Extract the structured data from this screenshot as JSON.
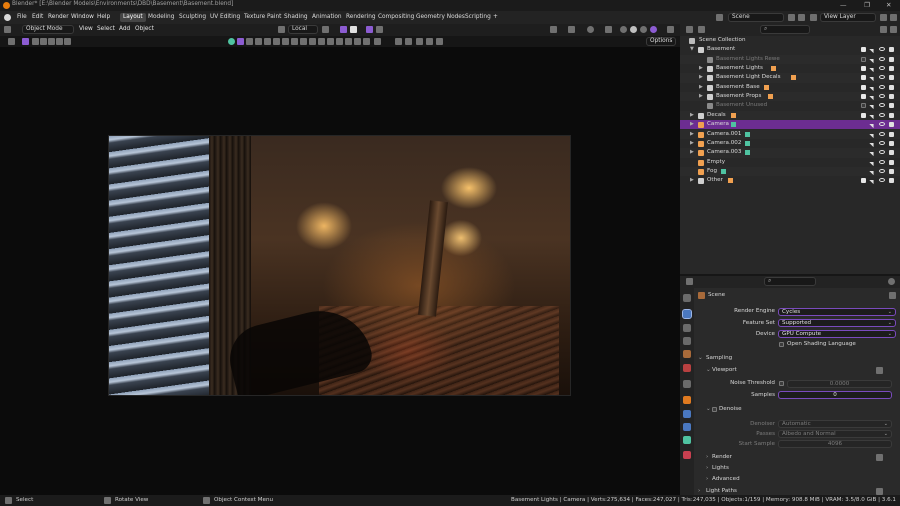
{
  "window": {
    "title": "Blender* [E:\\Blender Models\\Environments\\DBD\\Basement\\Basement.blend]",
    "controls": [
      "—",
      "❐",
      "✕"
    ]
  },
  "topbar": {
    "menus": [
      "File",
      "Edit",
      "Render",
      "Window",
      "Help"
    ],
    "workspaces": [
      "Layout",
      "Modeling",
      "Sculpting",
      "UV Editing",
      "Texture Paint",
      "Shading",
      "Animation",
      "Rendering",
      "Compositing",
      "Geometry Nodes",
      "Scripting"
    ],
    "active_workspace": "Layout",
    "add_tab": "+",
    "scene_name": "Scene",
    "view_layer": "View Layer"
  },
  "viewport_header": {
    "mode": "Object Mode",
    "menus": [
      "View",
      "Select",
      "Add",
      "Object"
    ],
    "transform_orientation": "Local",
    "options_label": "Options"
  },
  "outliner": {
    "root": "Scene Collection",
    "rows": [
      {
        "label": "Basement",
        "indent": 1,
        "icon": "collection-icon",
        "color": "#cfcfcf",
        "dim": false,
        "arrow": "▼",
        "check": true
      },
      {
        "label": "Basement Lights Rewe",
        "indent": 2,
        "icon": "collection-icon",
        "color": "#8a8a8a",
        "dim": true,
        "arrow": "",
        "check": false
      },
      {
        "label": "Basement Lights",
        "indent": 2,
        "icon": "collection-icon",
        "color": "#cfcfcf",
        "dim": false,
        "arrow": "▶",
        "check": true,
        "badge": "light-icon",
        "badgeColor": "#f0a050"
      },
      {
        "label": "Basement Light Decals",
        "indent": 2,
        "icon": "collection-icon",
        "color": "#cfcfcf",
        "dim": false,
        "arrow": "▶",
        "check": true,
        "badge": "funnel-icon",
        "badgeColor": "#f0a050"
      },
      {
        "label": "Basement Base",
        "indent": 2,
        "icon": "collection-icon",
        "color": "#cfcfcf",
        "dim": false,
        "arrow": "▶",
        "check": true,
        "badge": "mesh-icon",
        "badgeColor": "#f0a050"
      },
      {
        "label": "Basement Props",
        "indent": 2,
        "icon": "collection-icon",
        "color": "#cfcfcf",
        "dim": false,
        "arrow": "▶",
        "check": true,
        "badge": "mesh-icon",
        "badgeColor": "#f0a050"
      },
      {
        "label": "Basement Unused",
        "indent": 2,
        "icon": "collection-icon",
        "color": "#8a8a8a",
        "dim": true,
        "arrow": "",
        "check": false
      },
      {
        "label": "Decals",
        "indent": 1,
        "icon": "collection-icon",
        "color": "#cfcfcf",
        "dim": false,
        "arrow": "▶",
        "check": true,
        "badge": "mesh-icon",
        "badgeColor": "#f0a050"
      },
      {
        "label": "Camera",
        "indent": 1,
        "icon": "camera-object-icon",
        "color": "#f0a050",
        "dim": false,
        "arrow": "▶",
        "check": false,
        "selected": true,
        "badge": "camera-data-icon",
        "badgeColor": "#4fc3a1"
      },
      {
        "label": "Camera.001",
        "indent": 1,
        "icon": "camera-object-icon",
        "color": "#f0a050",
        "dim": false,
        "arrow": "▶",
        "check": false,
        "badge": "camera-data-icon",
        "badgeColor": "#4fc3a1"
      },
      {
        "label": "Camera.002",
        "indent": 1,
        "icon": "camera-object-icon",
        "color": "#f0a050",
        "dim": false,
        "arrow": "▶",
        "check": false,
        "badge": "camera-data-icon",
        "badgeColor": "#4fc3a1"
      },
      {
        "label": "Camera.003",
        "indent": 1,
        "icon": "camera-object-icon",
        "color": "#f0a050",
        "dim": false,
        "arrow": "▶",
        "check": false,
        "badge": "camera-data-icon",
        "badgeColor": "#4fc3a1"
      },
      {
        "label": "Empty",
        "indent": 1,
        "icon": "empty-icon",
        "color": "#f0a050",
        "dim": false,
        "arrow": "",
        "check": false
      },
      {
        "label": "Fog",
        "indent": 1,
        "icon": "mesh-object-icon",
        "color": "#f0a050",
        "dim": false,
        "arrow": "",
        "check": false,
        "badge": "funnel-icon",
        "badgeColor": "#4fc3a1"
      },
      {
        "label": "Other",
        "indent": 1,
        "icon": "collection-icon",
        "color": "#cfcfcf",
        "dim": false,
        "arrow": "▶",
        "check": true,
        "badge": "funnel-icon",
        "badgeColor": "#f0a050"
      }
    ]
  },
  "properties": {
    "context": "Scene",
    "render_engine_label": "Render Engine",
    "render_engine": "Cycles",
    "feature_set_label": "Feature Set",
    "feature_set": "Supported",
    "device_label": "Device",
    "device": "GPU Compute",
    "osl_label": "Open Shading Language",
    "sampling": "Sampling",
    "viewport": "Viewport",
    "noise_threshold_label": "Noise Threshold",
    "noise_threshold": "0.0000",
    "samples_label": "Samples",
    "samples": "0",
    "denoise": "Denoise",
    "denoiser_label": "Denoiser",
    "denoiser": "Automatic",
    "passes_label": "Passes",
    "passes": "Albedo and Normal",
    "start_sample_label": "Start Sample",
    "start_sample": "4096",
    "render": "Render",
    "lights": "Lights",
    "advanced": "Advanced",
    "light_paths": "Light Paths"
  },
  "statusbar": {
    "select": "Select",
    "rotate": "Rotate View",
    "context_menu": "Object Context Menu",
    "stats": "Basement Lights | Camera | Verts:275,634 | Faces:247,027 | Tris:247,035 | Objects:1/159 | Memory: 908.8 MiB | VRAM: 3.5/8.0 GiB | 3.6.1"
  }
}
